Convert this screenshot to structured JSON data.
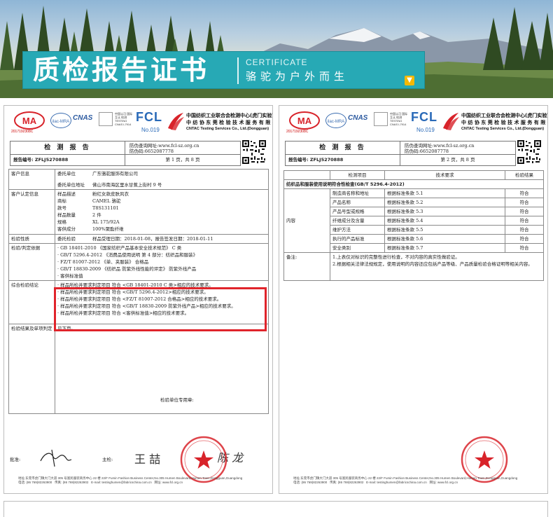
{
  "banner": {
    "title": "质检报告证书",
    "certificate_en": "CERTIFICATE",
    "slogan": "骆驼为户外而生",
    "down_icon": "chevron-down-icon"
  },
  "header": {
    "ma_number": "2017192308C",
    "ilac": "ilac-MRA",
    "cnas": "CNAS",
    "qr_caption": "中国认可 国际互认 检测 TESTING CNAS L7914",
    "fcl": "FCL",
    "fcl_no": "No.019",
    "lab_name_1": "中国纺织工业联合会检测中心(虎门实验室)",
    "lab_name_2": "中 纺 协 东 莞 检 验 技 术 服 务 有 限 公 司",
    "lab_name_en": "CNTAC Testing Services Co., Ltd.(Dongguan)"
  },
  "report_left": {
    "title": "检 测 报 告",
    "report_no_label": "报告编号:",
    "report_no": "ZFLJ5270888",
    "anti_fake_label": "防伪查询网址:",
    "anti_fake_url": "www.fcl-sz.org.cn",
    "anti_fake_code_label": "防伪码:",
    "anti_fake_code": "6652087778",
    "page": "第 1 页，共 8 页",
    "client_label": "客户信息",
    "client_unit_label": "委托单位",
    "client_unit": "广东骆驼服饰有限公司",
    "client_addr_label": "委托单位地址",
    "client_addr": "佛山市南海区里水甘蕉上街村 9 号",
    "sample_label": "客户认定信息",
    "sample_rows": [
      {
        "k": "样品描述",
        "v": "粉红女款皮肤风衣"
      },
      {
        "k": "商标",
        "v": "CAMEL 骆驼"
      },
      {
        "k": "款号",
        "v": "T8S131101"
      },
      {
        "k": "样品数量",
        "v": "2 件"
      },
      {
        "k": "规格",
        "v": "XL 175/92A"
      },
      {
        "k": "客供成分",
        "v": "100%聚酯纤维"
      }
    ],
    "nature_label": "检验性质",
    "nature_value": "委托检验",
    "received": "样品受理日期：2018-01-08，报告签发日期：2018-01-11",
    "basis_label": "检验/判定依据",
    "basis_rows": [
      "· GB 18401-2010 《国家纺织产品基本安全技术规范》 C 类",
      "· GB/T 5296.4-2012 《消费品使用说明 第 4 部分：纺织品和服装》",
      "· FZ/T 81007-2012 《单、夹服装》 合格品",
      "· GB/T 18830-2009 《纺织品 防紫外线性能的评定》 防紫外线产品",
      "· 客供标准值"
    ],
    "conclusion_label": "综合检验结论",
    "conclusion_rows": [
      "· 样品所检并要求判定项目 符合 <GB 18401-2010 C 类>相应的技术要求。",
      "· 样品所检并要求判定项目 符合 <GB/T 5296.4-2012>相应的技术要求。",
      "· 样品所检并要求判定项目 符合 <FZ/T 81007-2012 合格品>相应的技术要求。",
      "· 样品所检并要求判定项目 符合 <GB/T 18830-2009 防紫外线产品>相应的技术要求。",
      "· 样品所检并要求判定项目 符合 <客供标准值>相应的技术要求。"
    ],
    "result_label": "检验结果及单项判定",
    "result_value": "见下页。",
    "stamp_label": "检验单位专用章:",
    "approver_label": "批准:",
    "reviewer_label": "主检:",
    "reviewer_sign": "王 喆",
    "checker_sign": "陈 龙",
    "footer_addr": "地址:东莞市虎门镇大门大道 305 号富民服装商务中心 22 楼  22/F Fumin Fashion Business Center,No.305 Humen Boulevard,Humen Town,Dongguan,Guangdong",
    "footer_tel": "电话: (86 769)82263900",
    "footer_fax": "传真: (86 769)82263902",
    "footer_email": "E-mail: testinghumen@fabricschina.com.cn",
    "footer_web": "网址: www.fcl.org.cn"
  },
  "report_right": {
    "title": "检 测 报 告",
    "report_no_label": "报告编号:",
    "report_no": "ZFLJ5270888",
    "anti_fake_label": "防伪查询网址:",
    "anti_fake_url": "www.fcl-sz.org.cn",
    "anti_fake_code_label": "防伪码:",
    "anti_fake_code": "6652087778",
    "page": "第 2 页，共 8 页",
    "col_item": "检测项目",
    "col_req": "技术要求",
    "col_result": "检验结果",
    "section": "纺织品和服装使用说明符合性检查(GB/T 5296.4-2012)",
    "content_label": "内容",
    "rows": [
      {
        "item": "制造商名称和地址",
        "req": "根据标准条款 5.1",
        "result": "符合"
      },
      {
        "item": "产品名称",
        "req": "根据标准条款 5.2",
        "result": "符合"
      },
      {
        "item": "产品号型或规格",
        "req": "根据标准条款 5.3",
        "result": "符合"
      },
      {
        "item": "纤维成分及含量",
        "req": "根据标准条款 5.4",
        "result": "符合"
      },
      {
        "item": "维护方法",
        "req": "根据标准条款 5.5",
        "result": "符合"
      },
      {
        "item": "执行的产品标准",
        "req": "根据标准条款 5.6",
        "result": "符合"
      },
      {
        "item": "安全类别",
        "req": "根据标准条款 5.7",
        "result": "符合"
      }
    ],
    "note_label": "备注:",
    "notes": [
      "1.上表仅对标识的完整性进行检查，不对内容的真实性做验证。",
      "2.根据相关法律法规规定，使用说明的内容还应包括产品等级、产品质量检验合格证明等相关内容。"
    ],
    "footer_addr": "地址:东莞市虎门镇大门大道 305 号富民服装商务中心 22 楼  22/F Fumin Fashion Business Center,No.305 Humen Boulevard,Humen Town,Dongguan,Guangdong",
    "footer_tel": "电话: (86 769)82263900",
    "footer_fax": "传真: (86 769)82263902",
    "footer_email": "E-mail: testinghumen@fabricschina.com.cn",
    "footer_web": "网址: www.fcl.org.cn"
  },
  "colors": {
    "title_bar": "#27a9b5",
    "highlight": "#e0242b",
    "stamp": "#d8232a",
    "fcl": "#2a6ab8"
  }
}
